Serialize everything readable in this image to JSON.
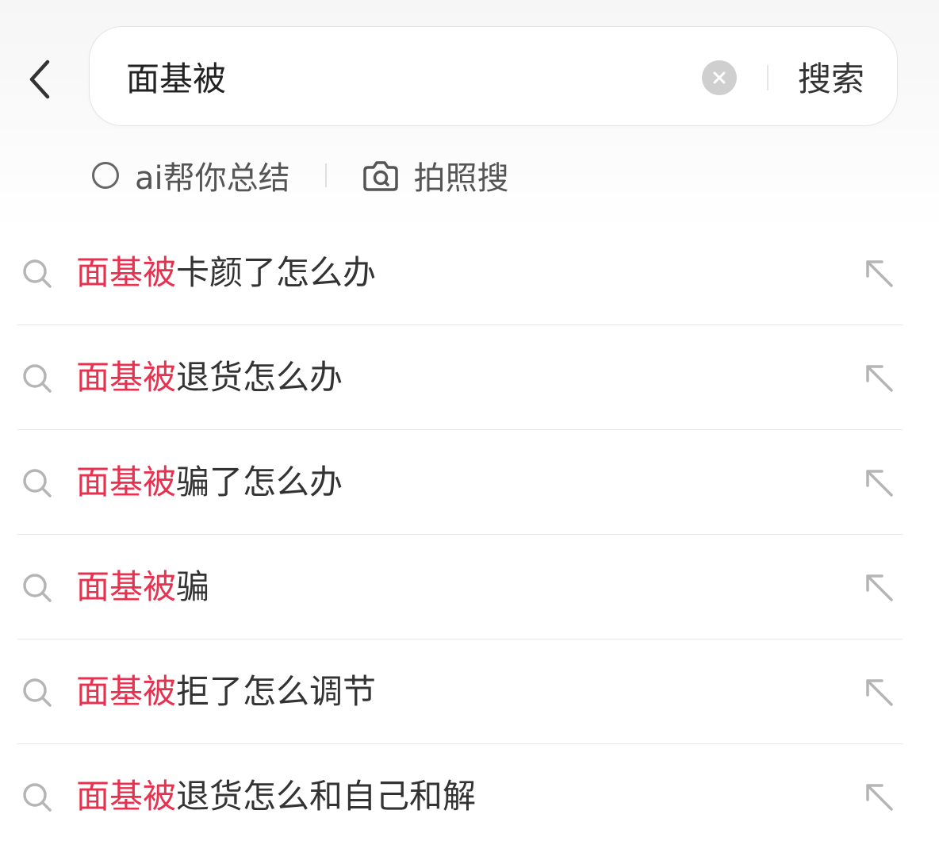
{
  "search": {
    "query": "面基被",
    "submit_label": "搜索"
  },
  "tools": {
    "ai_label": "ai帮你总结",
    "photo_label": "拍照搜"
  },
  "suggestions": [
    {
      "highlight": "面基被",
      "rest": "卡颜了怎么办"
    },
    {
      "highlight": "面基被",
      "rest": "退货怎么办"
    },
    {
      "highlight": "面基被",
      "rest": "骗了怎么办"
    },
    {
      "highlight": "面基被",
      "rest": "骗"
    },
    {
      "highlight": "面基被",
      "rest": "拒了怎么调节"
    },
    {
      "highlight": "面基被",
      "rest": "退货怎么和自己和解"
    }
  ],
  "colors": {
    "highlight": "#e8304f",
    "text": "#333333",
    "icon": "#b5b5b5"
  },
  "icons": {
    "back": "chevron-left-icon",
    "clear": "clear-circle-icon",
    "photo": "camera-icon",
    "suggestion": "search-icon",
    "fill": "arrow-up-left-icon"
  }
}
